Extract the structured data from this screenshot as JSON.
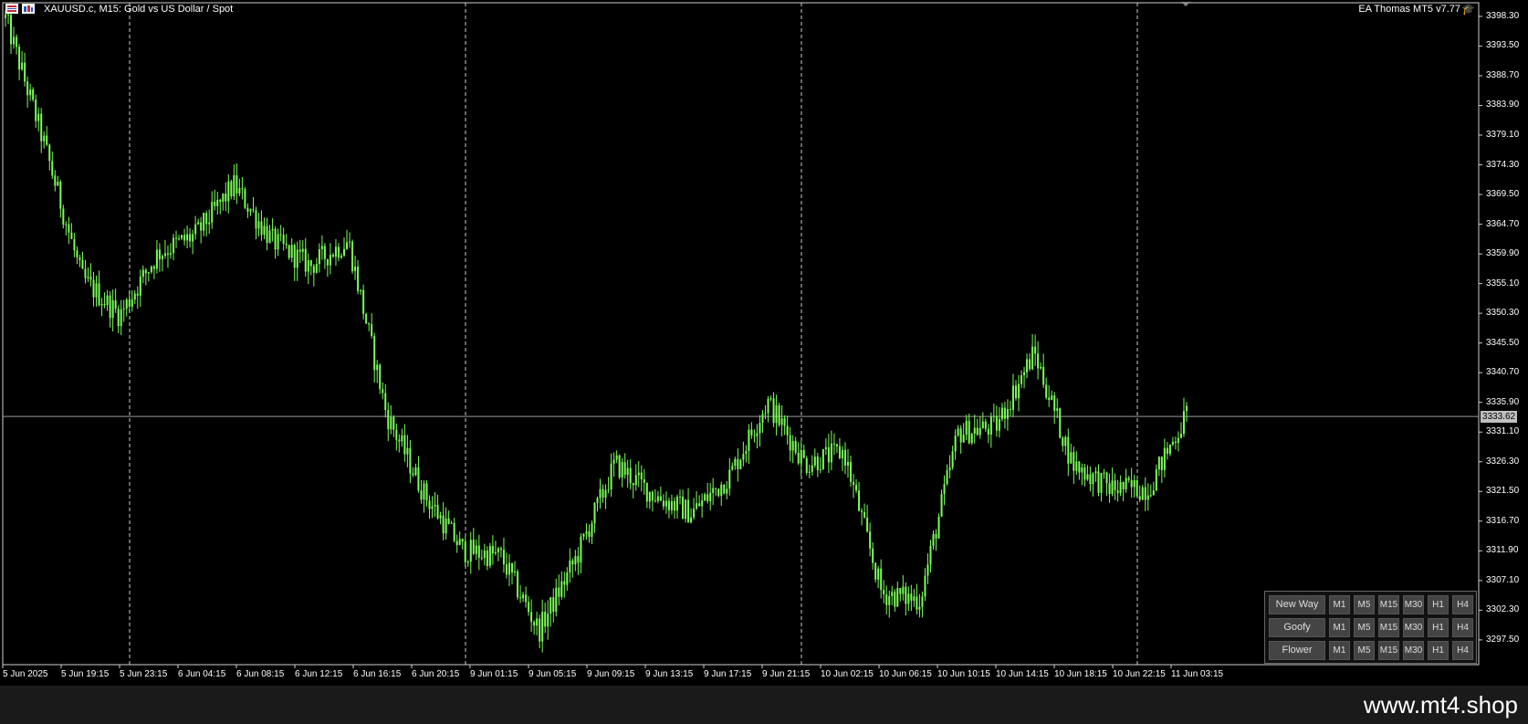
{
  "header": {
    "symbol_text": "XAUUSD.c, M15:  Gold vs US Dollar / Spot",
    "ea_label": "EA Thomas MT5 v7.77",
    "icons": [
      "chart-type-icon",
      "window-icon",
      "ea-hat-icon"
    ]
  },
  "price_axis": {
    "labels": [
      "3398.30",
      "3393.50",
      "3388.70",
      "3383.90",
      "3379.10",
      "3374.30",
      "3369.50",
      "3364.70",
      "3359.90",
      "3355.10",
      "3350.30",
      "3345.50",
      "3340.70",
      "3335.90",
      "3331.10",
      "3326.30",
      "3321.50",
      "3316.70",
      "3311.90",
      "3307.10",
      "3302.30",
      "3297.50"
    ],
    "current_price": "3333.62"
  },
  "time_axis": {
    "labels": [
      "5 Jun 2025",
      "5 Jun 19:15",
      "5 Jun 23:15",
      "6 Jun 04:15",
      "6 Jun 08:15",
      "6 Jun 12:15",
      "6 Jun 16:15",
      "6 Jun 20:15",
      "9 Jun 01:15",
      "9 Jun 05:15",
      "9 Jun 09:15",
      "9 Jun 13:15",
      "9 Jun 17:15",
      "9 Jun 21:15",
      "10 Jun 02:15",
      "10 Jun 06:15",
      "10 Jun 10:15",
      "10 Jun 14:15",
      "10 Jun 18:15",
      "10 Jun 22:15",
      "11 Jun 03:15"
    ]
  },
  "colors": {
    "background": "#000000",
    "candle": "#7CFC5A",
    "grid": "#bbbbbb"
  },
  "chart_data": {
    "type": "line",
    "series_style": "candlestick-green",
    "ylim": [
      3293.5,
      3400.5
    ],
    "x": [
      "5 Jun 2025",
      "5 Jun 19:15",
      "5 Jun 23:15",
      "6 Jun 04:15",
      "6 Jun 08:15",
      "6 Jun 12:15",
      "6 Jun 16:15",
      "6 Jun 20:15",
      "9 Jun 01:15",
      "9 Jun 05:15",
      "9 Jun 09:15",
      "9 Jun 13:15",
      "9 Jun 17:15",
      "9 Jun 21:15",
      "10 Jun 02:15",
      "10 Jun 06:15",
      "10 Jun 10:15",
      "10 Jun 14:15",
      "10 Jun 18:15",
      "10 Jun 22:15",
      "11 Jun 03:15"
    ],
    "series": [
      {
        "values": [
          3398,
          3378,
          3356,
          3350,
          3360,
          3363,
          3371,
          3362,
          3358,
          3362,
          3334,
          3321,
          3312,
          3311,
          3299,
          3311,
          3326,
          3321,
          3318,
          3324,
          3336,
          3326,
          3328,
          3305,
          3304,
          3331,
          3332,
          3344,
          3326,
          3322,
          3322,
          3334
        ]
      }
    ]
  },
  "panel": {
    "rows": [
      {
        "label": "New Way",
        "tfs": [
          "M1",
          "M5",
          "M15",
          "M30",
          "H1",
          "H4"
        ]
      },
      {
        "label": "Goofy",
        "tfs": [
          "M1",
          "M5",
          "M15",
          "M30",
          "H1",
          "H4"
        ]
      },
      {
        "label": "Flower",
        "tfs": [
          "M1",
          "M5",
          "M15",
          "M30",
          "H1",
          "H4"
        ]
      }
    ]
  },
  "footer": {
    "watermark": "www.mt4.shop"
  }
}
